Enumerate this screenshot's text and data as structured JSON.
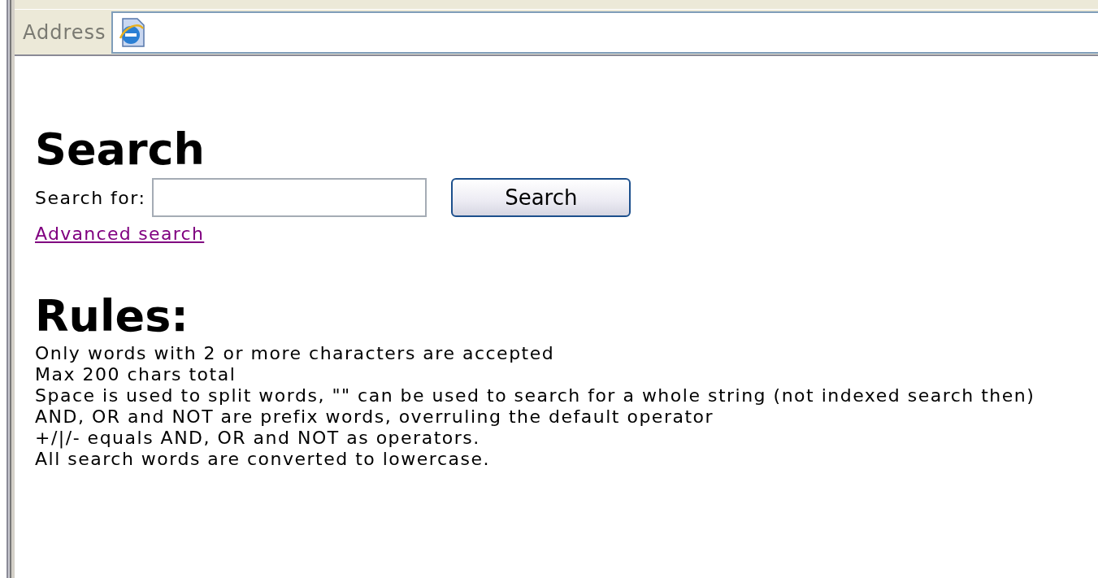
{
  "address_bar": {
    "label": "Address"
  },
  "page": {
    "title": "Search",
    "search_label": "Search for:",
    "search_button": "Search",
    "advanced_link": "Advanced search",
    "rules_title": "Rules:",
    "rules": [
      "Only words with 2 or more characters are accepted",
      "Max 200 chars total",
      "Space is used to split words, \"\" can be used to search for a whole string (not indexed search then)",
      "AND, OR and NOT are prefix words, overruling the default operator",
      "+/|/- equals AND, OR and NOT as operators.",
      "All search words are converted to lowercase."
    ]
  }
}
